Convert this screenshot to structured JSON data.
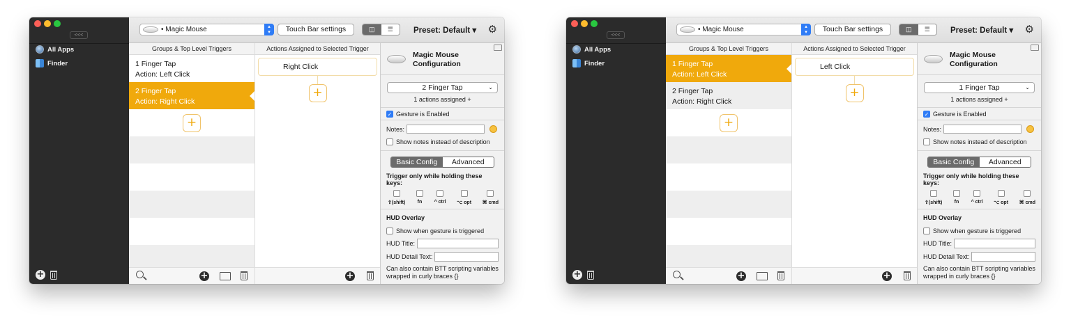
{
  "sidebar": {
    "collapse_label": "<<<",
    "apps": [
      "All Apps",
      "Finder"
    ]
  },
  "toolbar": {
    "device": "• Magic Mouse",
    "touchbar_label": "Touch Bar settings",
    "preset_label": "Preset: Default ▾",
    "view_icons": [
      "columns-icon",
      "list-icon"
    ]
  },
  "headers": {
    "groups": "Groups & Top Level Triggers",
    "actions": "Actions Assigned to Selected Trigger"
  },
  "config": {
    "title_line1": "Magic Mouse",
    "title_line2": "Configuration",
    "assigned": "1 actions assigned +",
    "gesture_enabled": "Gesture is Enabled",
    "notes_label": "Notes:",
    "show_notes": "Show notes instead of description",
    "tab_basic": "Basic Config",
    "tab_advanced": "Advanced",
    "trigger_keys_label": "Trigger only while holding these keys:",
    "keys": [
      "⇧(shift)",
      "fn",
      "^ ctrl",
      "⌥ opt",
      "⌘ cmd"
    ],
    "hud_overlay": "HUD Overlay",
    "hud_show": "Show when gesture is triggered",
    "hud_title": "HUD Title:",
    "hud_detail": "HUD Detail Text:",
    "hud_note": "Can also contain BTT scripting variables wrapped in curly braces {}"
  },
  "windows": [
    {
      "triggers": [
        {
          "name": "1 Finger Tap",
          "action": "Action: Left Click",
          "selected": false
        },
        {
          "name": "2 Finger Tap",
          "action": "Action: Right Click",
          "selected": true
        }
      ],
      "assigned_action": "Right Click",
      "dropdown": "2 Finger Tap"
    },
    {
      "triggers": [
        {
          "name": "1 Finger Tap",
          "action": "Action: Left Click",
          "selected": true
        },
        {
          "name": "2 Finger Tap",
          "action": "Action: Right Click",
          "selected": false
        }
      ],
      "assigned_action": "Left Click",
      "dropdown": "1 Finger Tap"
    }
  ],
  "colors": {
    "accent": "#f0a90c",
    "sidebar": "#2b2b2b",
    "checkbox": "#2f7cf6"
  }
}
